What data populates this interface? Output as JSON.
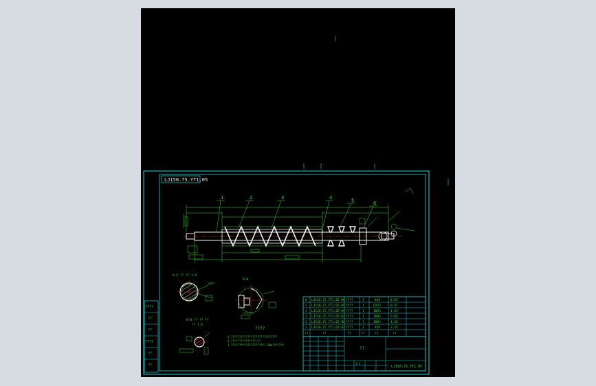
{
  "title_block": {
    "drawing_number": "LJ150.75.YT1.05",
    "drawing_number_mirrored": "LJ150.75.YT1.05",
    "name": "??",
    "scale_label": "1:5"
  },
  "balloons": [
    "1",
    "2",
    "3",
    "4",
    "5",
    "6"
  ],
  "section_views": {
    "a_a_title": "A-A ??  ?? 1:2",
    "b_b_title": "B-B",
    "detail_title": "B-B ?? ?? ??",
    "detail_subtitle": "?? 1:5"
  },
  "tech_requirements": {
    "heading": "????",
    "lines": [
      "1.????????????????????????????",
      "2.???????????????-3?",
      "3.?????????????????????-3mm???????"
    ]
  },
  "bom": [
    {
      "no": "6",
      "code": "LJ150.75.YT1.05-06",
      "name": "????",
      "qty": "1",
      "material": "45#",
      "weight": "0.52"
    },
    {
      "no": "5",
      "code": "LJ150.75.YT1.05-05",
      "name": "????",
      "qty": "1",
      "material": "Q235",
      "weight": "0.37"
    },
    {
      "no": "4",
      "code": "LJ150.75.YT1.05-04",
      "name": "????",
      "qty": "1",
      "material": "16Mn",
      "weight": "1.55"
    },
    {
      "no": "3",
      "code": "LJ150.75.YT1.05-03",
      "name": "????",
      "qty": "1",
      "material": "16Mn",
      "weight": "5.83"
    },
    {
      "no": "2",
      "code": "LJ150.75.YT1.05-02",
      "name": "????",
      "qty": "1",
      "material": "16Mn",
      "weight": "4.26"
    },
    {
      "no": "1",
      "code": "LJ150.75.YT1.05-01",
      "name": "????",
      "qty": "1",
      "material": "45#",
      "weight": "2.74"
    }
  ],
  "bom_header": {
    "no": "??",
    "code": "??",
    "name": "??",
    "qty": "??",
    "material": "??",
    "weight": "??"
  },
  "left_strip": [
    "????",
    "??",
    "??",
    "????",
    "??",
    "??"
  ],
  "colors": {
    "background": "#000000",
    "frame": "#23d8d8",
    "annotation": "#2fe02f",
    "geometry": "#f2f2f2",
    "center_line": "#e03030"
  }
}
